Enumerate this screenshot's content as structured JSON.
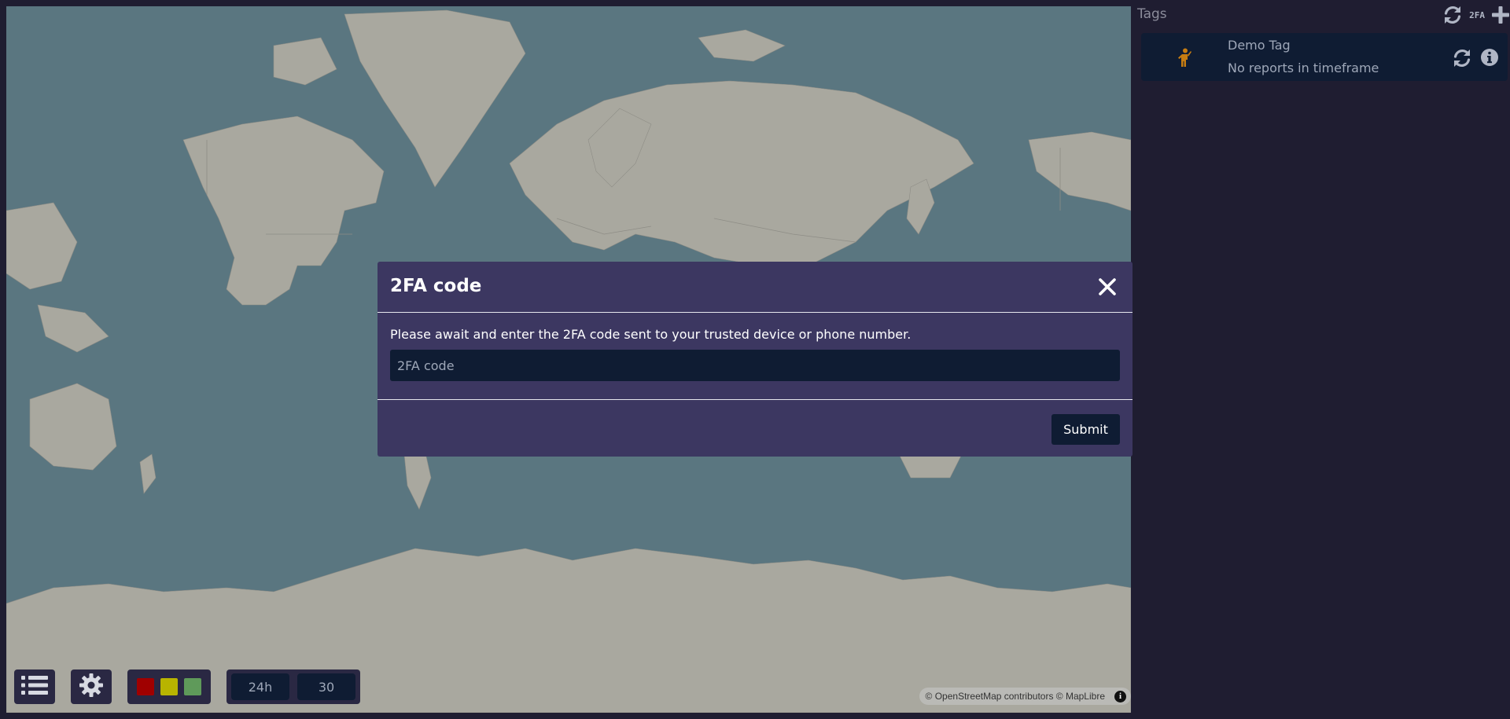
{
  "colors": {
    "map_water": "#5a7680",
    "land": "#a9a89f",
    "panel": "#2a2843",
    "sidebar_bg": "#1f1d31",
    "modal_bg": "#3c3761",
    "input_bg": "#0f1c33",
    "status_red": "#a00000",
    "status_yellow": "#b8b400",
    "status_green": "#5f9a5a",
    "tag_avatar": "#c77d12"
  },
  "map_controls": {
    "list_icon": "list-icon",
    "settings_icon": "gear-icon",
    "time_window": "24h",
    "count": "30",
    "attribution": "© OpenStreetMap contributors © MapLibre",
    "attribution_info_glyph": "i"
  },
  "sidebar": {
    "title": "Tags",
    "refresh_all_icon": "refresh-icon",
    "twofa_label": "2FA",
    "add_icon": "plus-icon",
    "tags": [
      {
        "name": "Demo Tag",
        "status": "No reports in timeframe",
        "avatar_icon": "person-icon",
        "refresh_icon": "refresh-icon",
        "info_icon": "info-icon"
      }
    ]
  },
  "modal": {
    "title": "2FA code",
    "close_icon": "close-icon",
    "message": "Please await and enter the 2FA code sent to your trusted device or phone number.",
    "input_placeholder": "2FA code",
    "input_value": "",
    "submit_label": "Submit"
  }
}
